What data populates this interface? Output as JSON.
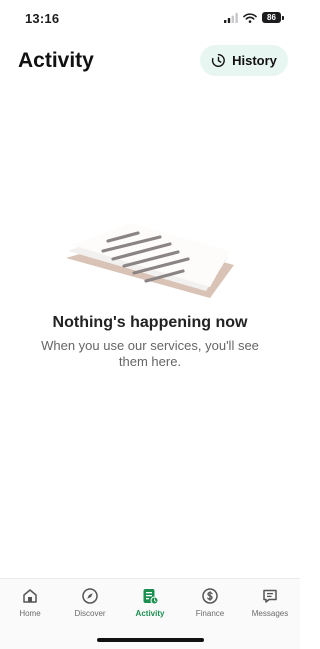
{
  "status_bar": {
    "time": "13:16",
    "battery": "86",
    "icons": [
      "signal-icon",
      "wifi-icon",
      "battery-icon"
    ]
  },
  "header": {
    "title": "Activity",
    "history_button": {
      "label": "History",
      "icon": "history-icon"
    }
  },
  "empty_state": {
    "illustration": "paper-document-illustration",
    "title": "Nothing's happening now",
    "description": "When you use our services, you'll see them here."
  },
  "bottom_nav": {
    "active": "Activity",
    "items": [
      {
        "label": "Home",
        "icon": "home-icon"
      },
      {
        "label": "Discover",
        "icon": "compass-icon"
      },
      {
        "label": "Activity",
        "icon": "activity-icon"
      },
      {
        "label": "Finance",
        "icon": "dollar-icon"
      },
      {
        "label": "Messages",
        "icon": "message-icon"
      }
    ]
  },
  "colors": {
    "accent": "#1a8f4f",
    "history_bg": "#e8f6f1",
    "text_primary": "#1c1c1e",
    "text_secondary": "#666666"
  }
}
